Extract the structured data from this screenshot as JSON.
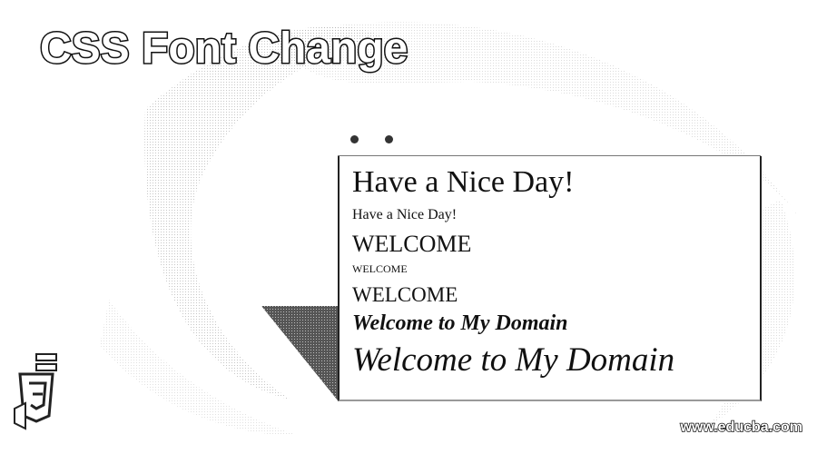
{
  "banner": {
    "title": "CSS Font Change"
  },
  "window": {
    "lines": [
      "Have a Nice Day!",
      "Have a Nice Day!",
      "WELCOME",
      "WELCOME",
      "WELCOME",
      "Welcome to My Domain",
      "Welcome to My Domain"
    ]
  },
  "logo": {
    "icon": "css3-icon"
  },
  "watermark": {
    "text": "www.educba.com"
  },
  "colors": {
    "background": "#ffffff",
    "ink": "#111111"
  }
}
